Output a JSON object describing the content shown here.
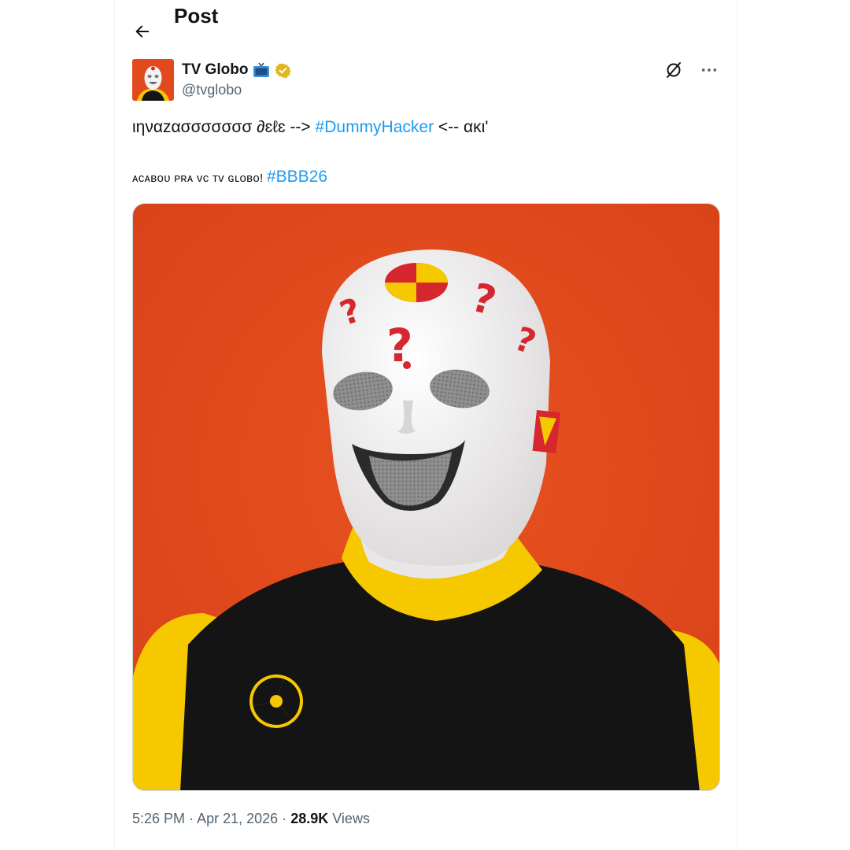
{
  "header": {
    "title": "Post"
  },
  "author": {
    "display_name": "TV Globo",
    "handle": "@tvglobo",
    "emoji": "📺"
  },
  "tweet": {
    "line1_text": "ιηναzασσσσσσσ ∂ɛℓɛ -->",
    "line1_hashtag": "#DummyHacker",
    "line1_tail": "<-- ακι'",
    "line2_text": "ᴀᴄᴀʙᴏᴜ ᴘʀᴀ ᴠᴄ ᴛᴠ ɢʟᴏʙᴏ!",
    "line2_hashtag": "#BBB26"
  },
  "meta": {
    "time": "5:26 PM",
    "separator": "·",
    "date": "Apr 21, 2026",
    "views_count": "28.9K",
    "views_label": "Views"
  },
  "colors": {
    "accent": "#1d9bf0",
    "verified_gold": "#e2b719",
    "media_background": "#e24a1e",
    "mask_white": "#f3f1f1",
    "suit_yellow": "#f5c800",
    "vest_black": "#141414"
  },
  "icons": [
    "back-arrow-icon",
    "tv-emoji-icon",
    "verified-badge-icon",
    "grok-icon",
    "more-icon",
    "radiation-symbol-icon"
  ]
}
